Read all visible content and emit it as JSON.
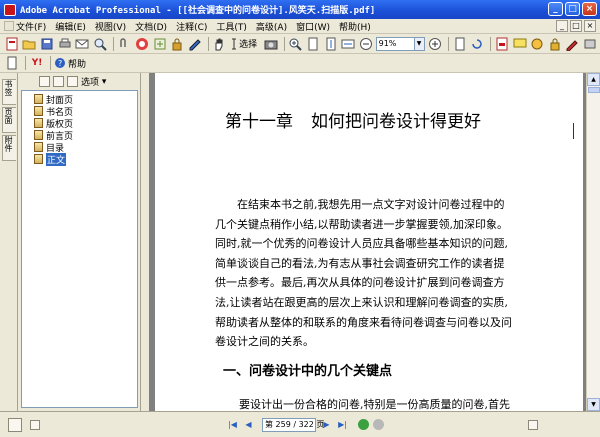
{
  "window": {
    "title": "Adobe Acrobat Professional - [[社会调查中的问卷设计].风笑天.扫描版.pdf]",
    "minimize": "_",
    "maximize": "□",
    "close": "×"
  },
  "menu": {
    "items": [
      "文件(F)",
      "编辑(E)",
      "视图(V)",
      "文档(D)",
      "注释(C)",
      "工具(T)",
      "高级(A)",
      "窗口(W)",
      "帮助(H)"
    ],
    "window_controls": [
      "_",
      "□",
      "×"
    ]
  },
  "toolbar1": {
    "select_label": "选择",
    "zoom_value": "91%",
    "zoom_out": "−",
    "zoom_in": "+"
  },
  "toolbar2": {
    "help_label": "帮助"
  },
  "bookmarks_panel": {
    "options_label": "选项",
    "tabs": [
      "书签",
      "页面",
      "附件"
    ],
    "items": [
      {
        "label": "封面页",
        "selected": false
      },
      {
        "label": "书名页",
        "selected": false
      },
      {
        "label": "版权页",
        "selected": false
      },
      {
        "label": "前言页",
        "selected": false
      },
      {
        "label": "目录",
        "selected": false
      },
      {
        "label": "正文",
        "selected": true
      }
    ]
  },
  "document": {
    "chapter_num": "第十一章",
    "chapter_title": "如何把问卷设计得更好",
    "paragraph_lines": [
      "在结束本书之前,我想先用一点文字对设计问卷过程中的",
      "几个关键点稍作小结,以帮助读者进一步掌握要领,加深印象。",
      "同时,就一个优秀的问卷设计人员应具备哪些基本知识的问题,",
      "简单谈谈自己的看法,为有志从事社会调查研究工作的读者提",
      "供一点参考。最后,再次从具体的问卷设计扩展到问卷调查方",
      "法,让读者站在跟更高的层次上来认识和理解问卷调查的实质,",
      "帮助读者从整体的和联系的角度来看待问卷调查与问卷以及问",
      "卷设计之间的关系。"
    ],
    "section_heading": "一、问卷设计中的几个关键点",
    "last_line": "要设计出一份合格的问卷,特别是一份高质量的问卷,首先"
  },
  "statusbar": {
    "page_display": "第 259 / 322 页",
    "first": "|◀",
    "prev": "◀",
    "next": "▶",
    "last": "▶|"
  },
  "colors": {
    "titlebar": "#1b4fd6",
    "selection": "#316ac5",
    "chrome": "#ece9d8"
  }
}
